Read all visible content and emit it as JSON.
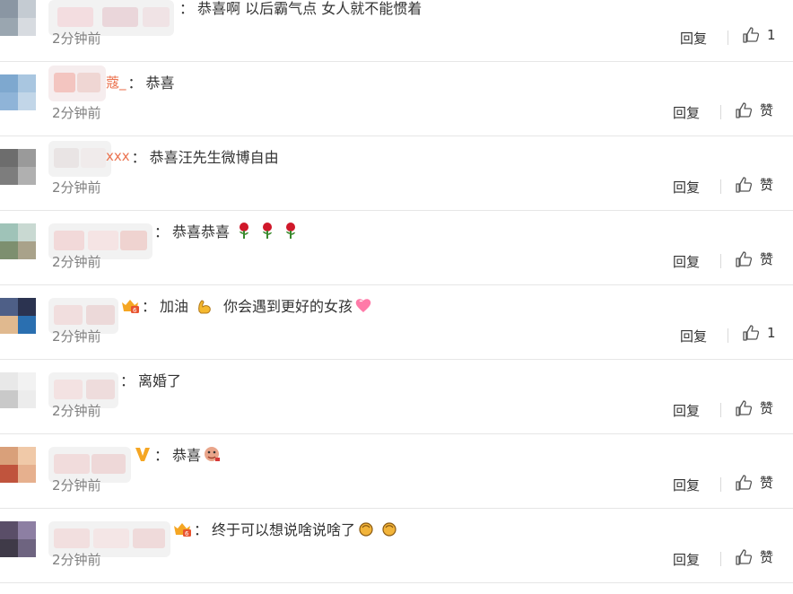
{
  "comments": [
    {
      "user": "",
      "text": "恭喜啊   以后霸气点  女人就不能惯着",
      "emojis": [],
      "badge": "",
      "time": "2分钟前",
      "reply": "回复",
      "like": "1"
    },
    {
      "user": "蔻_",
      "text": "恭喜",
      "emojis": [],
      "badge": "",
      "time": "2分钟前",
      "reply": "回复",
      "like": "赞"
    },
    {
      "user": "xxx",
      "text": "恭喜汪先生微博自由",
      "emojis": [],
      "badge": "",
      "time": "2分钟前",
      "reply": "回复",
      "like": "赞"
    },
    {
      "user": "",
      "text": "恭喜恭喜",
      "emojis": [
        "rose-emoji",
        "rose-emoji",
        "rose-emoji"
      ],
      "badge": "",
      "time": "2分钟前",
      "reply": "回复",
      "like": "赞"
    },
    {
      "user": "",
      "text": "加油",
      "text2": "你会遇到更好的女孩",
      "emojis": [
        "muscle-emoji"
      ],
      "emojis2": [
        "heart-emoji"
      ],
      "badge": "member-crown-icon",
      "time": "2分钟前",
      "reply": "回复",
      "like": "1"
    },
    {
      "user": "",
      "text": "离婚了",
      "emojis": [],
      "badge": "",
      "time": "2分钟前",
      "reply": "回复",
      "like": "赞"
    },
    {
      "user": "",
      "text": "恭喜",
      "emojis": [
        "doge-emoji"
      ],
      "badge": "verified-v-icon",
      "time": "2分钟前",
      "reply": "回复",
      "like": "赞"
    },
    {
      "user": "",
      "text": "终于可以想说啥说啥了",
      "emojis": [
        "clap-emoji",
        "clap-emoji"
      ],
      "badge": "member-crown-icon",
      "time": "2分钟前",
      "reply": "回复",
      "like": "赞"
    }
  ],
  "colors": {
    "username": "#eb7350",
    "time": "#808080",
    "divider": "#e6e6e6",
    "verified": "#f5a623"
  }
}
